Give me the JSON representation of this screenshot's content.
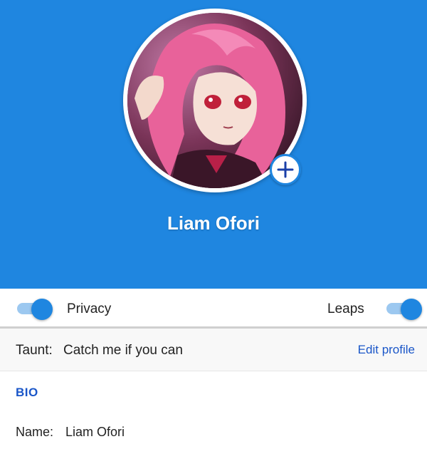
{
  "profile": {
    "display_name": "Liam Ofori",
    "avatar_alt": "anime-character-avatar",
    "add_photo_icon": "plus-icon"
  },
  "toggles": {
    "privacy_label": "Privacy",
    "privacy_on": true,
    "leaps_label": "Leaps",
    "leaps_on": true
  },
  "taunt": {
    "label": "Taunt:",
    "value": "Catch me if you can",
    "edit_label": "Edit profile"
  },
  "bio": {
    "title": "BIO",
    "name_label": "Name:",
    "name_value": "Liam Ofori"
  },
  "colors": {
    "header_bg": "#1f86e0",
    "accent": "#1a56c8",
    "toggle_track": "#9cc8f0"
  }
}
